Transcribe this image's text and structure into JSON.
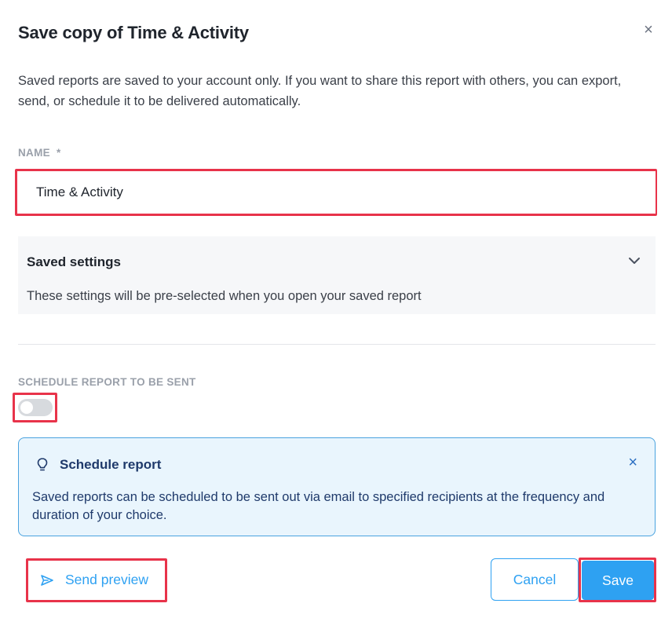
{
  "dialog": {
    "title": "Save copy of Time & Activity",
    "close_symbol": "×",
    "description": "Saved reports are saved to your account only. If you want to share this report with others, you can export, send, or schedule it to be delivered automatically."
  },
  "name_field": {
    "label": "NAME",
    "required_marker": "*",
    "value": "Time & Activity"
  },
  "saved_settings": {
    "title": "Saved settings",
    "description": "These settings will be pre-selected when you open your saved report",
    "icon": "chevron-down-icon"
  },
  "schedule": {
    "label": "SCHEDULE REPORT TO BE SENT",
    "toggle_on": false
  },
  "info_box": {
    "icon": "lightbulb-icon",
    "title": "Schedule report",
    "close_symbol": "×",
    "description": "Saved reports can be scheduled to be sent out via email to specified recipients at the frequency and duration of your choice."
  },
  "footer": {
    "send_preview_label": "Send preview",
    "send_icon": "send-icon",
    "cancel_label": "Cancel",
    "save_label": "Save"
  },
  "colors": {
    "accent": "#2ea1f2",
    "highlight": "#e8334a",
    "info_bg": "#e9f5fd"
  }
}
